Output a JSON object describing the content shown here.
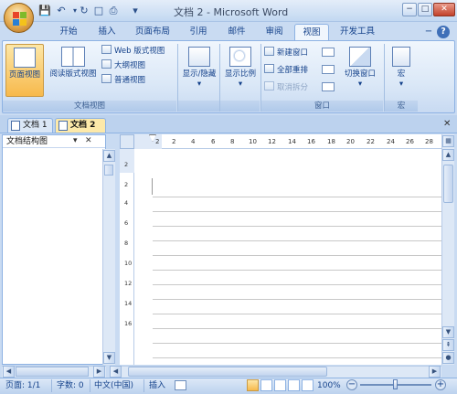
{
  "window": {
    "title": "文档 2 - Microsoft Word",
    "minimize": "−",
    "restore": "□",
    "close": "✕"
  },
  "quick_access": {
    "save": "💾",
    "undo": "↶",
    "redo": "↻",
    "new_doc": "□",
    "print": "⎙",
    "customize": "▾"
  },
  "ribbon_tabs": [
    "开始",
    "插入",
    "页面布局",
    "引用",
    "邮件",
    "审阅",
    "视图",
    "开发工具"
  ],
  "active_tab": "视图",
  "help": "?",
  "ribbon_min": "−",
  "groups": {
    "doc_views": {
      "label": "文档视图",
      "page_view": "页面视图",
      "reading_view": "阅读版式视图",
      "web_view": "Web 版式视图",
      "outline_view": "大纲视图",
      "draft_view": "普通视图"
    },
    "show_hide": {
      "label": "显示/隐藏"
    },
    "zoom": {
      "label": "显示比例"
    },
    "window": {
      "label": "窗口",
      "new_window": "新建窗口",
      "arrange_all": "全部重排",
      "remove_split": "取消拆分",
      "switch_windows": "切换窗口"
    },
    "macros": {
      "label": "宏",
      "button": "宏"
    }
  },
  "doc_tabs": [
    "文档 1",
    "文档 2"
  ],
  "doc_tabs_close": "✕",
  "nav_pane": {
    "title": "文档结构图",
    "dropdown": "▾",
    "close": "✕"
  },
  "ruler_numbers": [
    "2",
    "2",
    "4",
    "6",
    "8",
    "10",
    "12",
    "14",
    "16",
    "18",
    "20",
    "22",
    "24",
    "26",
    "28"
  ],
  "vruler_numbers": [
    "2",
    "2",
    "4",
    "6",
    "8",
    "10",
    "12",
    "14",
    "16"
  ],
  "status": {
    "page": "页面: 1/1",
    "words": "字数: 0",
    "language": "中文(中国)",
    "insert_mode": "插入",
    "zoom_level": "100%",
    "zoom_out": "−",
    "zoom_in": "+"
  }
}
